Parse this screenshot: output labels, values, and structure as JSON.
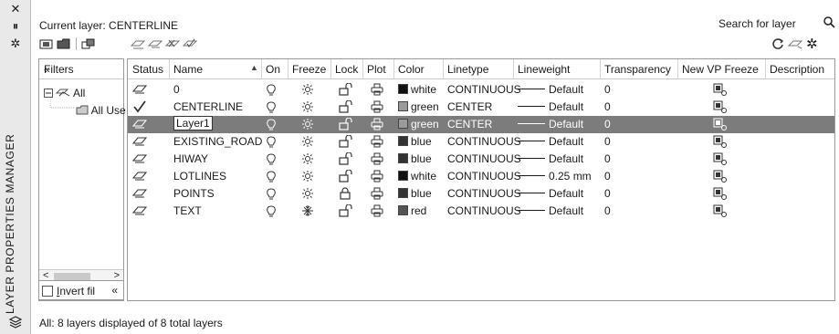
{
  "panel": {
    "vertical_title": "LAYER PROPERTIES MANAGER",
    "current_layer_label": "Current layer: CENTERLINE",
    "search_placeholder": "Search for layer"
  },
  "filters": {
    "header": "Filters",
    "collapse_label": "«",
    "tree_all": "All",
    "tree_all_used": "All Use",
    "invert_label_u": "I",
    "invert_label_rest": "nvert fil",
    "invert_collapse": "«",
    "scroll_left": "<",
    "scroll_right": ">"
  },
  "columns": [
    "Status",
    "Name",
    "On",
    "Freeze",
    "Lock",
    "Plot",
    "Color",
    "Linetype",
    "Lineweight",
    "Transparency",
    "New VP Freeze",
    "Description"
  ],
  "rows": [
    {
      "status": "layer",
      "name": "0",
      "on": "on",
      "freeze": "thawed",
      "lock": "unlocked",
      "plot": "plot",
      "color_name": "white",
      "color_hex": "#111111",
      "linetype": "CONTINUOUS",
      "lineweight": "Default",
      "transparency": "0",
      "selected": false
    },
    {
      "status": "current",
      "name": "CENTERLINE",
      "on": "on",
      "freeze": "thawed",
      "lock": "unlocked",
      "plot": "plot",
      "color_name": "green",
      "color_hex": "#9a9a9a",
      "linetype": "CENTER",
      "lineweight": "Default",
      "transparency": "0",
      "selected": false
    },
    {
      "status": "layer",
      "name": "Layer1",
      "on": "on",
      "freeze": "thawed",
      "lock": "unlocked",
      "plot": "plot",
      "color_name": "green",
      "color_hex": "#9a9a9a",
      "linetype": "CENTER",
      "lineweight": "Default",
      "transparency": "0",
      "selected": true
    },
    {
      "status": "layer",
      "name": "EXISTING_ROAD",
      "on": "on",
      "freeze": "thawed",
      "lock": "unlocked",
      "plot": "plot",
      "color_name": "blue",
      "color_hex": "#333333",
      "linetype": "CONTINUOUS",
      "lineweight": "Default",
      "transparency": "0",
      "selected": false
    },
    {
      "status": "layer",
      "name": "HIWAY",
      "on": "on",
      "freeze": "thawed",
      "lock": "unlocked",
      "plot": "plot",
      "color_name": "blue",
      "color_hex": "#333333",
      "linetype": "CONTINUOUS",
      "lineweight": "Default",
      "transparency": "0",
      "selected": false
    },
    {
      "status": "layer",
      "name": "LOTLINES",
      "on": "on",
      "freeze": "thawed",
      "lock": "unlocked",
      "plot": "plot",
      "color_name": "white",
      "color_hex": "#111111",
      "linetype": "CONTINUOUS",
      "lineweight": "0.25 mm",
      "transparency": "0",
      "selected": false
    },
    {
      "status": "layer",
      "name": "POINTS",
      "on": "on",
      "freeze": "thawed",
      "lock": "locked",
      "plot": "plot",
      "color_name": "blue",
      "color_hex": "#333333",
      "linetype": "CONTINUOUS",
      "lineweight": "Default",
      "transparency": "0",
      "selected": false
    },
    {
      "status": "layer",
      "name": "TEXT",
      "on": "on",
      "freeze": "frozen",
      "lock": "unlocked",
      "plot": "plot",
      "color_name": "red",
      "color_hex": "#555555",
      "linetype": "CONTINUOUS",
      "lineweight": "Default",
      "transparency": "0",
      "selected": false
    }
  ],
  "status_bar": "All: 8 layers displayed of 8 total layers"
}
